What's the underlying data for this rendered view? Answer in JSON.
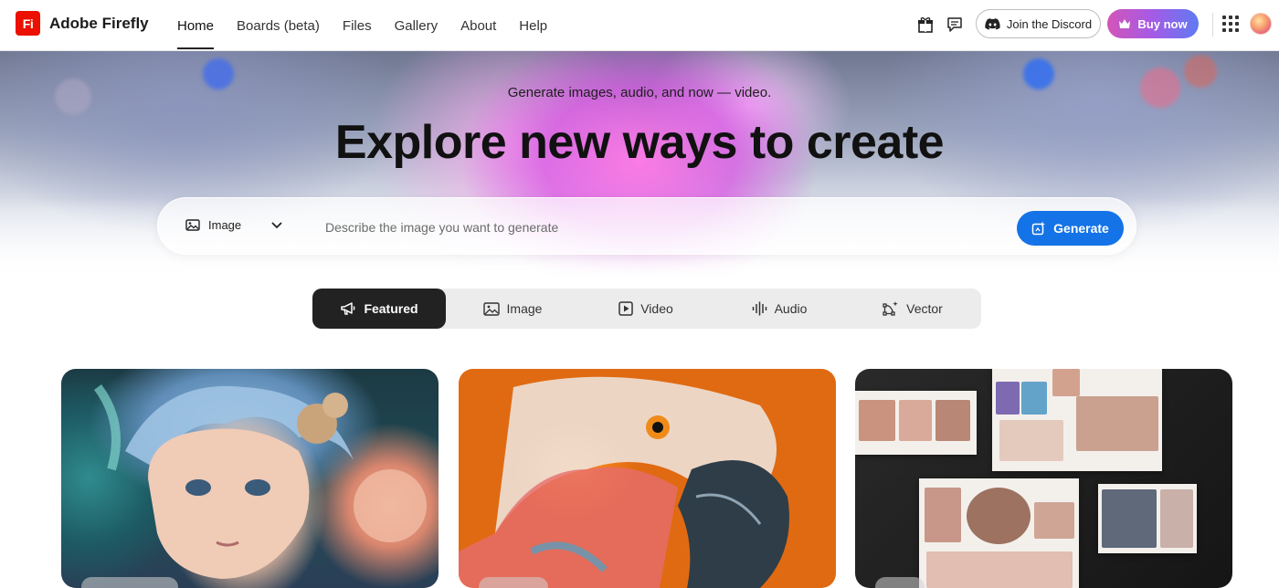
{
  "header": {
    "logo_mark": "Fi",
    "app_name": "Adobe Firefly",
    "nav": [
      {
        "label": "Home",
        "active": true
      },
      {
        "label": "Boards (beta)",
        "active": false
      },
      {
        "label": "Files",
        "active": false
      },
      {
        "label": "Gallery",
        "active": false
      },
      {
        "label": "About",
        "active": false
      },
      {
        "label": "Help",
        "active": false
      }
    ],
    "icons": [
      "gift-icon",
      "chat-icon"
    ],
    "discord_label": "Join the Discord",
    "buy_label": "Buy now"
  },
  "hero": {
    "subtitle": "Generate images, audio, and now — video.",
    "title": "Explore new ways to create",
    "prompt": {
      "type_selected": "Image",
      "placeholder": "Describe the image you want to generate",
      "value": "",
      "generate_label": "Generate"
    }
  },
  "tabs": [
    {
      "label": "Featured",
      "icon": "megaphone-icon",
      "active": true
    },
    {
      "label": "Image",
      "icon": "image-icon",
      "active": false
    },
    {
      "label": "Video",
      "icon": "video-icon",
      "active": false
    },
    {
      "label": "Audio",
      "icon": "audio-wave-icon",
      "active": false
    },
    {
      "label": "Vector",
      "icon": "vector-icon",
      "active": false
    }
  ],
  "cards": [
    {
      "subject": "fantasy-portrait"
    },
    {
      "subject": "parrot-closeup"
    },
    {
      "subject": "moodboard-collage"
    }
  ],
  "colors": {
    "brand_red": "#eb1000",
    "generate_blue": "#1473e6",
    "active_tab": "#222222",
    "buy_gradient_start": "#d355b8",
    "buy_gradient_end": "#5f7af2"
  }
}
